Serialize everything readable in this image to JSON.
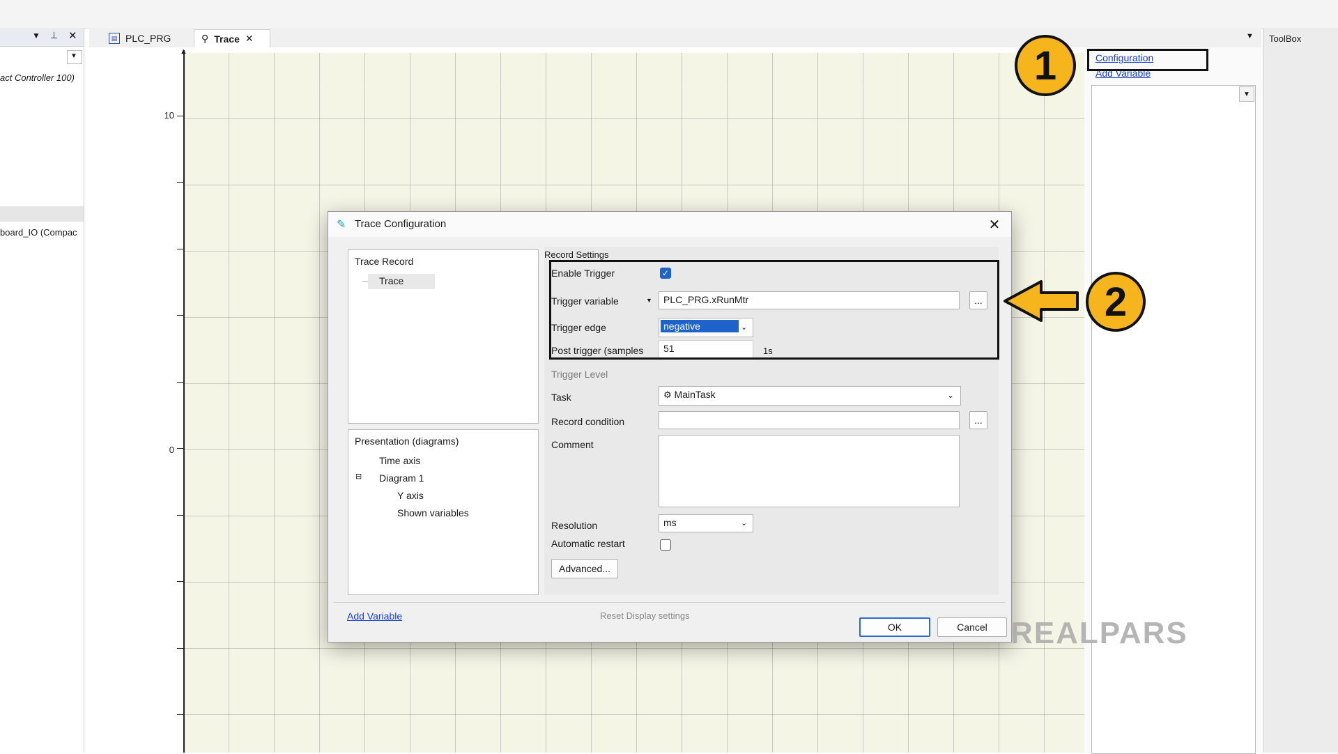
{
  "editor": {
    "tabs": [
      {
        "label": "PLC_PRG",
        "icon": "program-icon"
      },
      {
        "label": "Trace",
        "icon": "trace-icon"
      }
    ]
  },
  "left_panel": {
    "items": [
      {
        "label": "act Controller 100)"
      },
      {
        "label": "board_IO (Compac"
      }
    ]
  },
  "chart_data": {
    "type": "line",
    "title": "",
    "xlabel": "",
    "ylabel": "",
    "y_ticks": [
      "10",
      "0"
    ],
    "ylim": [
      -4,
      11
    ],
    "grid": true,
    "series": []
  },
  "right_panel": {
    "configuration_link": "Configuration",
    "add_variable_link": "Add Variable"
  },
  "toolbox": {
    "title": "ToolBox"
  },
  "callouts": {
    "one": "1",
    "two": "2"
  },
  "dialog": {
    "title": "Trace Configuration",
    "tree_top": {
      "root": "Trace Record",
      "child": "Trace"
    },
    "tree_bottom": {
      "root": "Presentation (diagrams)",
      "items": [
        "Time axis",
        "Diagram 1",
        "Y axis",
        "Shown variables"
      ]
    },
    "record_settings": "Record Settings",
    "enable_trigger_label": "Enable Trigger",
    "enable_trigger_checked": true,
    "trigger_variable_label": "Trigger variable",
    "trigger_variable_value": "PLC_PRG.xRunMtr",
    "trigger_edge_label": "Trigger edge",
    "trigger_edge_value": "negative",
    "post_trigger_label": "Post trigger (samples",
    "post_trigger_value": "51",
    "post_trigger_unit": "1s",
    "trigger_level_label": "Trigger  Level",
    "task_label": "Task",
    "task_value": "MainTask",
    "record_condition_label": "Record condition",
    "record_condition_value": "",
    "comment_label": "Comment",
    "resolution_label": "Resolution",
    "resolution_value": "ms",
    "automatic_restart_label": "Automatic restart",
    "automatic_restart_checked": false,
    "advanced_button": "Advanced...",
    "ellipsis": "...",
    "add_variable_link": "Add Variable",
    "reset_display": "Reset Display settings",
    "ok_button": "OK",
    "cancel_button": "Cancel"
  },
  "watermark": "REALPARS",
  "colors": {
    "accent": "#1e63c9",
    "callout": "#f6b51c",
    "plot_bg": "#f5f5e6"
  }
}
